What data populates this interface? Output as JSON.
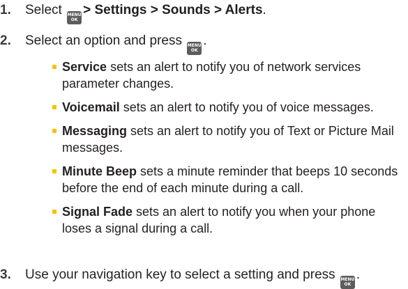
{
  "steps": [
    {
      "number": "1.",
      "prefix": "Select",
      "path": "> Settings > Sounds > Alerts",
      "suffix": "."
    },
    {
      "number": "2.",
      "prefix": "Select an option and press",
      "suffix": "."
    },
    {
      "number": "3.",
      "prefix": "Use your navigation key to select a setting and press",
      "suffix": "."
    }
  ],
  "menu_key": {
    "top": "MENU",
    "bottom": "OK",
    "icon": "menu-ok-key-icon"
  },
  "options": [
    {
      "term": "Service",
      "description": " sets an alert to notify you of network services parameter changes."
    },
    {
      "term": "Voicemail",
      "description": " sets an alert to notify you of voice messages."
    },
    {
      "term": "Messaging",
      "description": " sets an alert to notify you of Text or Picture Mail messages."
    },
    {
      "term": "Minute Beep",
      "description": " sets a minute reminder that beeps 10 seconds before the end of each minute during a call."
    },
    {
      "term": "Signal Fade",
      "description": " sets an alert to notify you when your phone loses a signal during a call."
    }
  ],
  "colors": {
    "bullet": "#f2c500",
    "text": "#231f20",
    "key": "#5c5c5c"
  }
}
